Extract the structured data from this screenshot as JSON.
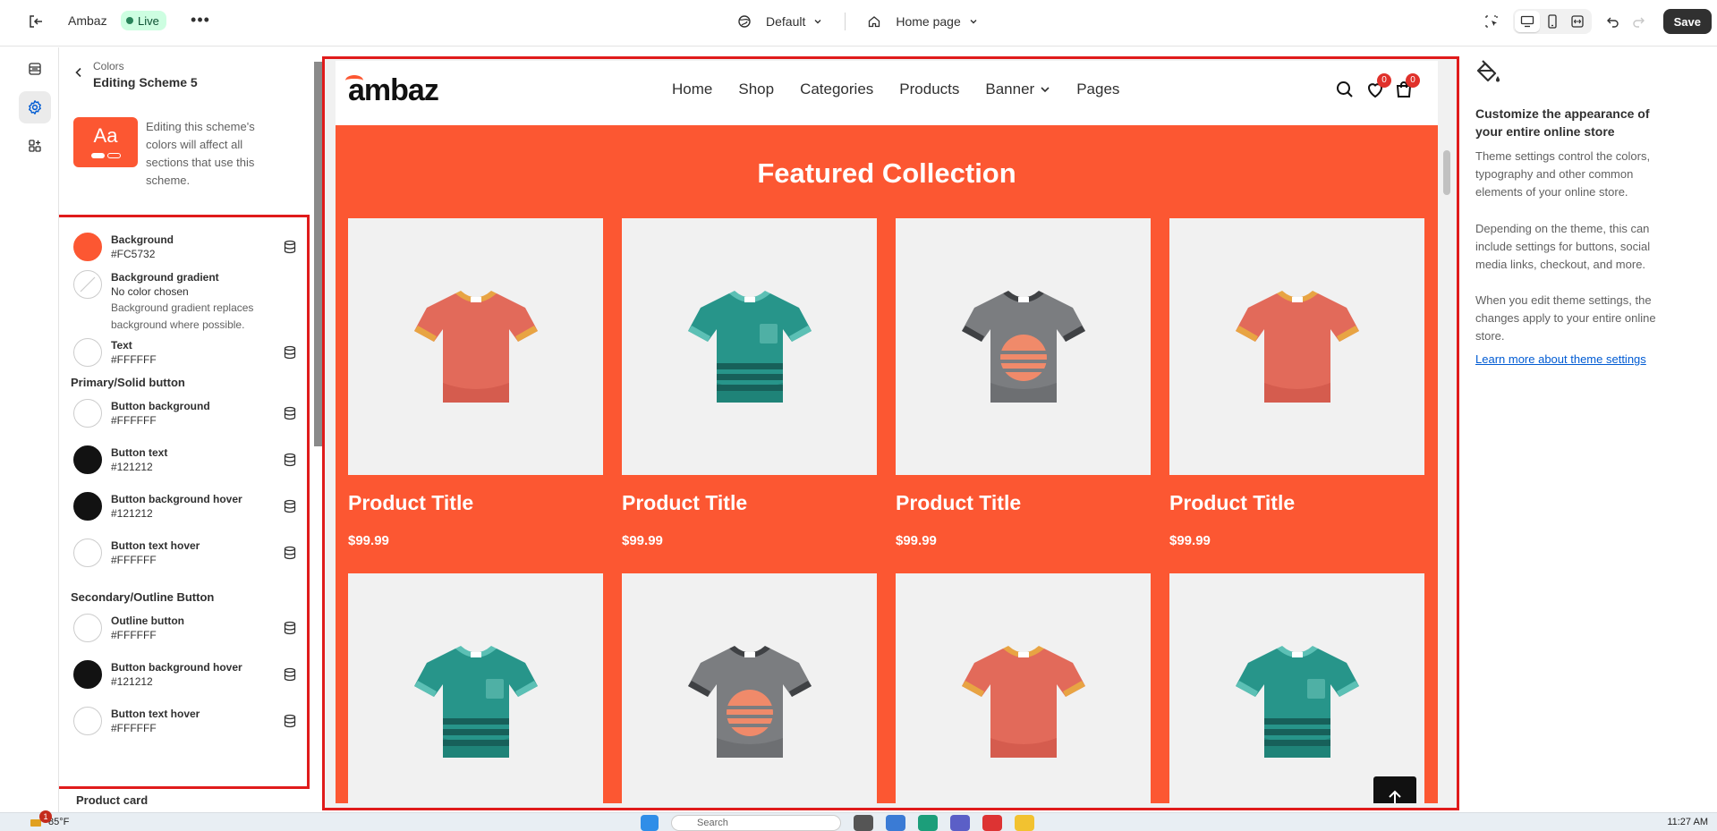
{
  "topbar": {
    "store_name": "Ambaz",
    "status": "Live",
    "more_label": "•••",
    "theme": "Default",
    "page": "Home page",
    "save_label": "Save"
  },
  "panel": {
    "breadcrumb": "Colors",
    "title": "Editing Scheme 5",
    "scheme_preview_text": "Aa",
    "scheme_note": "Editing this scheme's colors will affect all sections that use this scheme.",
    "rows": [
      {
        "label": "Background",
        "value": "#FC5732",
        "swatch": "#FC5732"
      },
      {
        "label": "Background gradient",
        "value": "No color chosen",
        "desc": "Background gradient replaces background where possible.",
        "swatch": "none"
      },
      {
        "label": "Text",
        "value": "#FFFFFF",
        "swatch": "#FFFFFF"
      },
      {
        "label": "Button background",
        "value": "#FFFFFF",
        "swatch": "#FFFFFF"
      },
      {
        "label": "Button text",
        "value": "#121212",
        "swatch": "#121212"
      },
      {
        "label": "Button background hover",
        "value": "#121212",
        "swatch": "#121212"
      },
      {
        "label": "Button text hover",
        "value": "#FFFFFF",
        "swatch": "#FFFFFF"
      },
      {
        "label": "Outline button",
        "value": "#FFFFFF",
        "swatch": "#FFFFFF"
      },
      {
        "label": "Button background hover",
        "value": "#121212",
        "swatch": "#121212"
      },
      {
        "label": "Button text hover",
        "value": "#FFFFFF",
        "swatch": "#FFFFFF"
      }
    ],
    "sections": {
      "primary": "Primary/Solid button",
      "secondary": "Secondary/Outline Button",
      "product_card": "Product card"
    }
  },
  "preview": {
    "logo": "ambaz",
    "nav": [
      "Home",
      "Shop",
      "Categories",
      "Products",
      "Banner",
      "Pages"
    ],
    "wishlist_count": "0",
    "cart_count": "0",
    "section_title": "Featured Collection",
    "products": [
      {
        "title": "Product Title",
        "price": "$99.99",
        "shirt": "coral"
      },
      {
        "title": "Product Title",
        "price": "$99.99",
        "shirt": "teal"
      },
      {
        "title": "Product Title",
        "price": "$99.99",
        "shirt": "gray"
      },
      {
        "title": "Product Title",
        "price": "$99.99",
        "shirt": "coral"
      }
    ],
    "row2_shirts": [
      "teal",
      "gray",
      "coral",
      "teal"
    ]
  },
  "info": {
    "title": "Customize the appearance of your entire online store",
    "p1": "Theme settings control the colors, typography and other common elements of your online store.",
    "p2": "Depending on the theme, this can include settings for buttons, social media links, checkout, and more.",
    "p3": "When you edit theme settings, the changes apply to your entire online store.",
    "link": "Learn more about theme settings"
  },
  "taskbar": {
    "notification_count": "1",
    "temperature": "85°F",
    "search_placeholder": "Search",
    "time": "11:27 AM"
  },
  "colors": {
    "accent": "#FC5732",
    "highlight_border": "#e01b1b",
    "live_green": "#29845a"
  }
}
